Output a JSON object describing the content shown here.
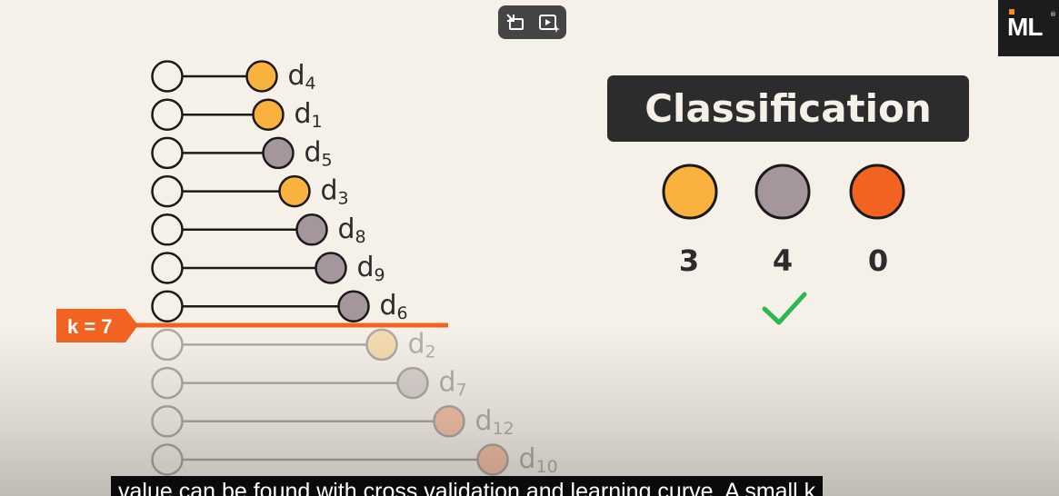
{
  "neighbors": [
    {
      "label": "d",
      "sub": "4",
      "class": "yellow",
      "dist": 104,
      "active": true
    },
    {
      "label": "d",
      "sub": "1",
      "class": "yellow",
      "dist": 111,
      "active": true
    },
    {
      "label": "d",
      "sub": "5",
      "class": "gray",
      "dist": 122,
      "active": true
    },
    {
      "label": "d",
      "sub": "3",
      "class": "yellow",
      "dist": 140,
      "active": true
    },
    {
      "label": "d",
      "sub": "8",
      "class": "gray",
      "dist": 159,
      "active": true
    },
    {
      "label": "d",
      "sub": "9",
      "class": "gray",
      "dist": 180,
      "active": true
    },
    {
      "label": "d",
      "sub": "6",
      "class": "gray",
      "dist": 205,
      "active": true
    },
    {
      "label": "d",
      "sub": "2",
      "class": "yellow",
      "dist": 236,
      "active": false
    },
    {
      "label": "d",
      "sub": "7",
      "class": "gray",
      "dist": 270,
      "active": false
    },
    {
      "label": "d",
      "sub": "12",
      "class": "orange",
      "dist": 310,
      "active": false
    },
    {
      "label": "d",
      "sub": "10",
      "class": "orange",
      "dist": 358,
      "active": false
    }
  ],
  "k_label": "k = 7",
  "classification": {
    "title": "Classification",
    "classes": [
      {
        "class": "yellow",
        "count": "3"
      },
      {
        "class": "gray",
        "count": "4"
      },
      {
        "class": "orange",
        "count": "0"
      }
    ],
    "winner_index": 1
  },
  "colors": {
    "yellow": "#f9b23d",
    "gray": "#a4969b",
    "orange": "#f26322",
    "accent": "#f26322",
    "check": "#2ab84f",
    "dark": "#2c2c2c"
  },
  "logo_text": "ML",
  "logo_reg": "®",
  "player_controls": [
    "exit-fullscreen-icon",
    "autoplay-icon"
  ],
  "caption": "value can be found with cross validation and learning curve. A small k"
}
